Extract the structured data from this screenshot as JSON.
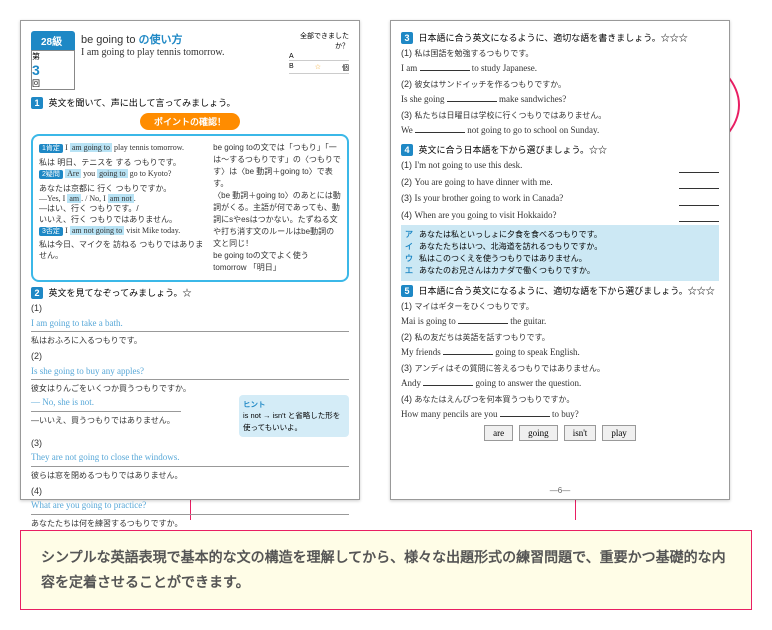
{
  "left": {
    "grade": "28級",
    "lesson_top": "第",
    "lesson_num": "3",
    "lesson_suffix": "回",
    "title_prefix": "be going to ",
    "title_hl": "の使い方",
    "title_en": "I am going to play tennis tomorrow.",
    "score1_label": "全部できましたか？",
    "score_a": "A",
    "score_b": "B",
    "score_star": "☆",
    "score_unit": "個",
    "s1_title": "英文を聞いて、声に出して言ってみましょう。",
    "point_banner": "ポイントの確認！",
    "g1_tag": "1肯定",
    "g1_en": "I am going to play tennis tomorrow.",
    "g1_jp": "私は 明日、テニスを する つもりです。",
    "g2_tag": "2疑問",
    "g2_en": "Are you going to go to Kyoto?",
    "g2_jp": "あなたは京都に 行く つもりですか。",
    "g2_a1": "—Yes, I am. / No, I am not.",
    "g2_a1jp": "—はい、行く つもりです。/",
    "g2_a2jp": "いいえ、行く つもりではありません。",
    "g3_tag": "3否定",
    "g3_en": "I am not going to visit Mike today.",
    "g3_jp": "私は今日、マイクを 訪ねる つもりではありません。",
    "gr1": "be going toの文では「つもり」「一は～するつもりです」の〈つもりです〉は〈be 動詞＋going to〉で表す。",
    "gr2": "〈be 動詞＋going to〉のあとには動詞がくる。主語が何であっても、動詞にsやesはつかない。たずねる文や打ち消す文のルールはbe動詞の文と同じ！",
    "gr3": "be going toの文でよく使うtomorrow 「明日」",
    "s2_title": "英文を見てなぞってみましょう。☆",
    "q2_1_en": "I am going to take a bath.",
    "q2_1_jp": "私はおふろに入るつもりです。",
    "q2_2_en": "Is she going to buy any apples?",
    "q2_2_jp": "彼女はりんごをいくつか買うつもりですか。",
    "q2_2a_en": "— No, she is not.",
    "q2_2a_jp": "—いいえ、買うつもりではありません。",
    "q2_3_en": "They are not going to close the windows.",
    "q2_3_jp": "彼らは窓を閉めるつもりではありません。",
    "q2_4_en": "What are you going to practice?",
    "q2_4_jp": "あなたたちは何を練習するつもりですか。",
    "hint_title": "ヒント",
    "hint_body": "is not → isn't と省略した形を使ってもいいよ。"
  },
  "right": {
    "s3_title": "日本語に合う英文になるように、適切な語を書きましょう。☆☆☆",
    "q3_1_jp": "私は国語を勉強するつもりです。",
    "q3_1_en_a": "I am ",
    "q3_1_en_b": " to study Japanese.",
    "q3_2_jp": "彼女はサンドイッチを作るつもりですか。",
    "q3_2_en_a": "Is she going ",
    "q3_2_en_b": " make sandwiches?",
    "q3_3_jp": "私たちは日曜日は学校に行くつもりではありません。",
    "q3_3_en_a": "We ",
    "q3_3_en_b": " not going to go to school on Sunday.",
    "s4_title": "英文に合う日本語を下から選びましょう。☆☆",
    "q4_1": "I'm not going to use this desk.",
    "q4_2": "You are going to have dinner with me.",
    "q4_3": "Is your brother going to work in Canada?",
    "q4_4": "When are you going to visit Hokkaido?",
    "c_a": "あなたは私といっしょに夕食を食べるつもりです。",
    "c_i": "あなたたちはいつ、北海道を訪れるつもりですか。",
    "c_u": "私はこのつくえを使うつもりではありません。",
    "c_e": "あなたのお兄さんはカナダで働くつもりですか。",
    "s5_title": "日本語に合う英文になるように、適切な語を下から選びましょう。☆☆☆",
    "q5_1_jp": "マイはギターをひくつもりです。",
    "q5_1_en_a": "Mai is going to ",
    "q5_1_en_b": " the guitar.",
    "q5_2_jp": "私の友だちは英語を話すつもりです。",
    "q5_2_en_a": "My friends ",
    "q5_2_en_b": " going to speak English.",
    "q5_3_jp": "アンディはその質問に答えるつもりではありません。",
    "q5_3_en_a": "Andy ",
    "q5_3_en_b": " going to answer the question.",
    "q5_4_jp": "あなたはえんぴつを何本買うつもりですか。",
    "q5_4_en_a": "How many pencils are you ",
    "q5_4_en_b": " to buy?",
    "w1": "are",
    "w2": "going",
    "w3": "isn't",
    "w4": "play",
    "page_num": "—6—"
  },
  "caption": "シンプルな英語表現で基本的な文の構造を理解してから、様々な出題形式の練習問題で、重要かつ基礎的な内容を定着させることができます。"
}
